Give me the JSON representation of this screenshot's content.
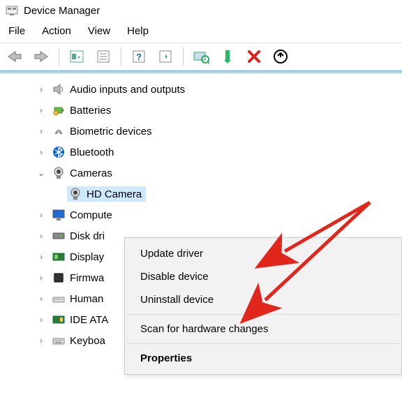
{
  "window": {
    "title": "Device Manager"
  },
  "menubar": {
    "file": "File",
    "action": "Action",
    "view": "View",
    "help": "Help"
  },
  "tree": {
    "items": [
      {
        "label": "Audio inputs and outputs",
        "expanded": false
      },
      {
        "label": "Batteries",
        "expanded": false
      },
      {
        "label": "Biometric devices",
        "expanded": false
      },
      {
        "label": "Bluetooth",
        "expanded": false
      },
      {
        "label": "Cameras",
        "expanded": true,
        "children": [
          {
            "label": "HD Camera",
            "selected": true
          }
        ]
      },
      {
        "label": "Computer",
        "expanded": false,
        "truncated": "Compute"
      },
      {
        "label": "Disk drives",
        "expanded": false,
        "truncated": "Disk dri"
      },
      {
        "label": "Display adapters",
        "expanded": false,
        "truncated": "Display"
      },
      {
        "label": "Firmware",
        "expanded": false,
        "truncated": "Firmwa"
      },
      {
        "label": "Human Interface Devices",
        "expanded": false,
        "truncated": "Human"
      },
      {
        "label": "IDE ATA/ATAPI controllers",
        "expanded": false,
        "truncated": "IDE ATA"
      },
      {
        "label": "Keyboards",
        "expanded": false,
        "truncated": "Keyboa"
      }
    ]
  },
  "context_menu": {
    "update": "Update driver",
    "disable": "Disable device",
    "uninstall": "Uninstall device",
    "scan": "Scan for hardware changes",
    "properties": "Properties"
  }
}
